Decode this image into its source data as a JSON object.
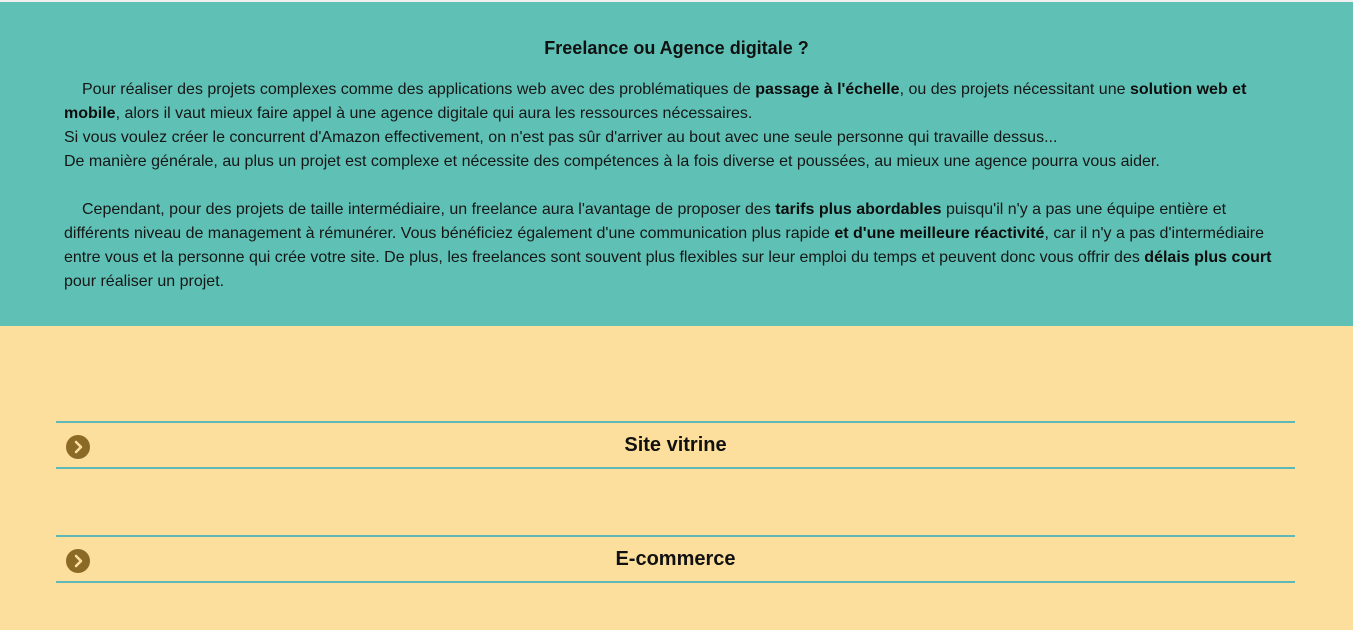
{
  "info": {
    "title": "Freelance ou Agence digitale ?",
    "p1": {
      "s1": "Pour réaliser des projets complexes comme des applications web avec des problématiques de ",
      "b1": "passage à l'échelle",
      "s2": ", ou des projets nécessitant une ",
      "b2": "solution web et mobile",
      "s3": ", alors il vaut mieux faire appel à une agence digitale qui aura les ressources nécessaires.",
      "line2": "Si vous voulez créer le concurrent d'Amazon effectivement, on n'est pas sûr d'arriver au bout avec une seule personne qui travaille dessus...",
      "line3": "De manière générale, au plus un projet est complexe et nécessite des compétences à la fois diverse et poussées, au mieux une agence pourra vous aider."
    },
    "p2": {
      "s1": "Cependant, pour des projets de taille intermédiaire, un freelance aura l'avantage de proposer des ",
      "b1": "tarifs plus abordables",
      "s2": " puisqu'il n'y a pas une équipe entière et différents niveau de management à rémunérer. Vous bénéficiez également d'une communication plus rapide ",
      "b2": "et d'une meilleure réactivité",
      "s3": ", car il n'y a pas d'intermédiaire entre vous et la personne qui crée votre site. De plus, les freelances sont souvent plus flexibles sur leur emploi du temps et peuvent donc vous offrir des ",
      "b3": "délais plus court",
      "s4": " pour réaliser un projet."
    }
  },
  "accordion": {
    "items": [
      {
        "label": "Site vitrine",
        "icon": "chevron-right-circle-icon"
      },
      {
        "label": "E-commerce",
        "icon": "chevron-right-circle-icon"
      }
    ]
  },
  "colors": {
    "info_background": "#5fc1b5",
    "page_background": "#fcdf9c",
    "accordion_border": "#5fb8b8",
    "icon_fill": "#8b6a26"
  }
}
